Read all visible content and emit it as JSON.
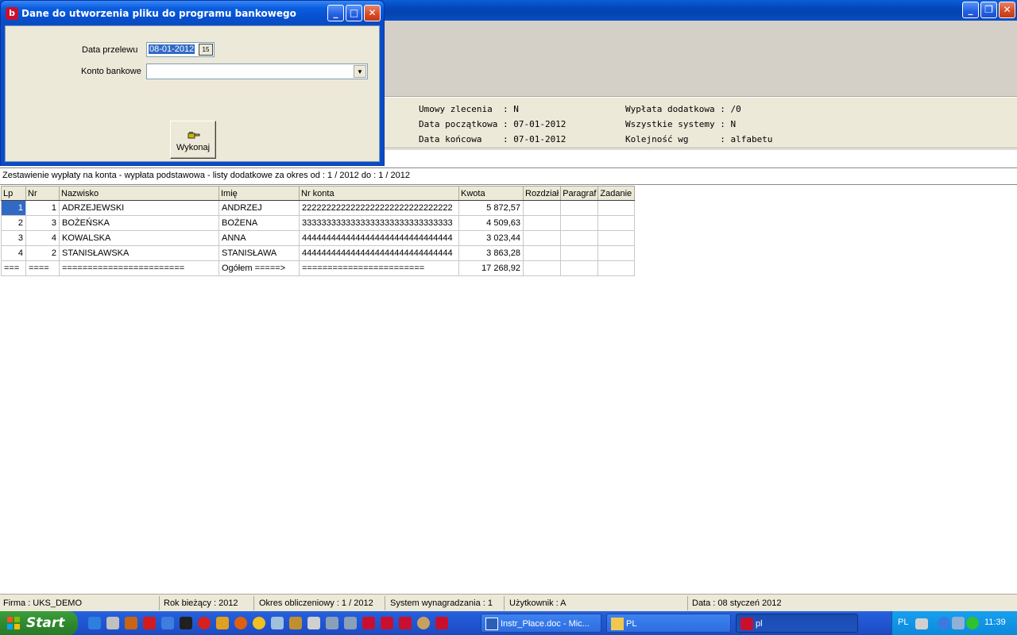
{
  "dialog": {
    "title": "Dane do utworzenia pliku do programu bankowego",
    "date_label": "Data przelewu",
    "date_value": "08-01-2012",
    "date_button": "15",
    "account_label": "Konto bankowe",
    "account_value": "",
    "execute_label": "Wykonaj"
  },
  "info": {
    "umowy": "Umowy zlecenia  : N",
    "data_pocz": "Data początkowa : 07-01-2012",
    "data_konc": "Data końcowa    : 07-01-2012",
    "wyplata_dod": "Wypłata dodatkowa : /0",
    "systemy": "Wszystkie systemy : N",
    "kolejnosc": "Kolejność wg      : alfabetu"
  },
  "report": {
    "title": "Zestawienie wypłaty na konta - wypłata podstawowa - listy dodatkowe za okres od : 1 / 2012 do : 1 / 2012"
  },
  "grid": {
    "headers": [
      "Lp",
      "Nr",
      "Nazwisko",
      "Imię",
      "Nr konta",
      "Kwota",
      "Rozdział",
      "Paragraf",
      "Zadanie"
    ],
    "rows": [
      [
        "1",
        "1",
        "ADRZEJEWSKI",
        "ANDRZEJ",
        "2222222222222222222222222222222",
        "5 872,57",
        "",
        "",
        ""
      ],
      [
        "2",
        "3",
        "BOŻEŃSKA",
        "BOŻENA",
        "3333333333333333333333333333333",
        "4 509,63",
        "",
        "",
        ""
      ],
      [
        "3",
        "4",
        "KOWALSKA",
        "ANNA",
        "4444444444444444444444444444444",
        "3 023,44",
        "",
        "",
        ""
      ],
      [
        "4",
        "2",
        "STANISŁAWSKA",
        "STANISŁAWA",
        "4444444444444444444444444444444",
        "3 863,28",
        "",
        "",
        ""
      ],
      [
        "===",
        "====",
        "========================",
        "Ogółem =====>",
        "========================",
        "17 268,92",
        "",
        "",
        ""
      ]
    ]
  },
  "status": {
    "firma": "Firma : UKS_DEMO",
    "rok": "Rok bieżący : 2012",
    "okres": "Okres obliczeniowy : 1 / 2012",
    "system": "System wynagradzania : 1",
    "uzytkownik": "Użytkownik : A",
    "data": "Data : 08 styczeń 2012"
  },
  "taskbar": {
    "start_label": "Start",
    "tasks": [
      "Instr_Płace.doc - Mic...",
      "PL",
      "pl"
    ],
    "lang": "PL",
    "clock": "11:39"
  },
  "colors": {
    "selection": "#316ac5",
    "dialog_frame": "#0a4cc8",
    "window_face": "#ece9d8"
  }
}
